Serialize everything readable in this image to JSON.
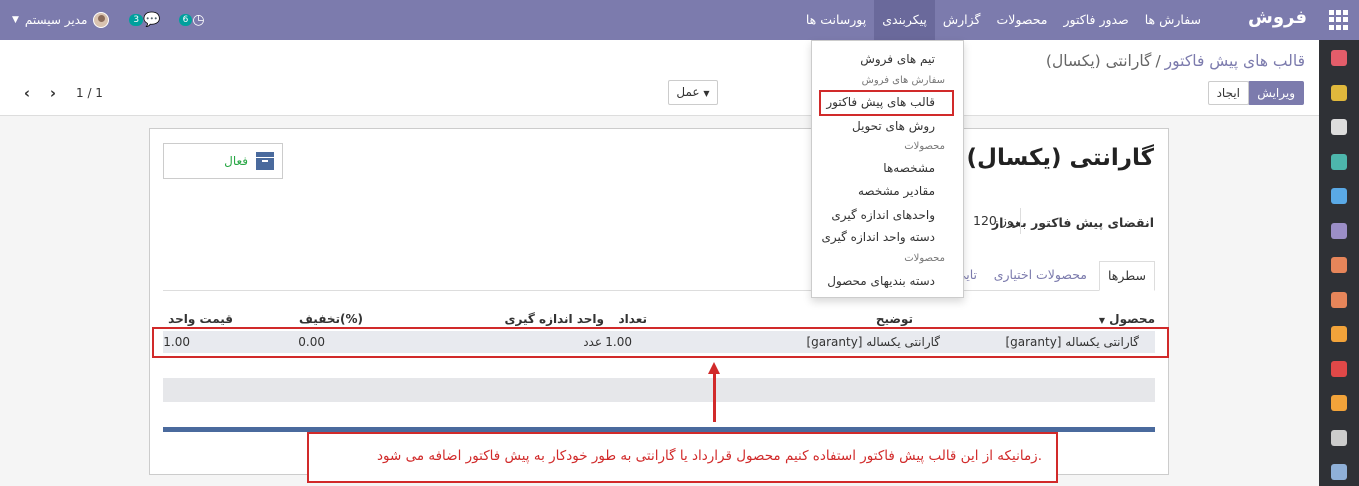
{
  "navbar": {
    "brand": "فروش",
    "menu": [
      "سفارش ها",
      "صدور فاکتور",
      "محصولات",
      "گزارش",
      "پیکربندی",
      "پورسانت ها"
    ],
    "active_menu": "پیکربندی",
    "user_name": "مدیر سیستم",
    "messages_badge": "3",
    "activities_badge": "6"
  },
  "breadcrumb": {
    "parent": "قالب های پیش فاکتور",
    "separator": "/",
    "current": "گارانتی (یکسال)"
  },
  "toolbar": {
    "edit_label": "ویرایش",
    "create_label": "ایجاد",
    "action_label": "عمل",
    "pager": "1 / 1"
  },
  "form": {
    "status_label": "فعال",
    "title": "گارانتی (یکسال)",
    "expiry_label": "انقضای پیش فاکتور بعد از",
    "expiry_value": "120 روز",
    "tabs": [
      "سطرها",
      "محصولات اختیاری",
      "تایی"
    ],
    "columns": [
      "محصول",
      "توضیح",
      "تعداد",
      "واحد اندازه گیری",
      "تخفیف(%)",
      "قیمت واحد"
    ],
    "rows": [
      {
        "product": "[garanty] گارانتی یکساله",
        "description": "[garanty] گارانتی یکساله",
        "quantity": "1.00",
        "uom": "عدد",
        "discount": "0.00",
        "unit_price": "1.00"
      }
    ]
  },
  "dropdown": {
    "items": [
      {
        "type": "item",
        "label": "تیم های فروش"
      },
      {
        "type": "header",
        "label": "سفارش های فروش"
      },
      {
        "type": "item",
        "label": "قالب های پیش فاکتور",
        "highlighted": true
      },
      {
        "type": "item",
        "label": "روش های تحویل"
      },
      {
        "type": "header",
        "label": "محصولات"
      },
      {
        "type": "item",
        "label": "مشخصه‌ها"
      },
      {
        "type": "item",
        "label": "مقادیر مشخصه"
      },
      {
        "type": "item",
        "label": "واحدهای اندازه گیری"
      },
      {
        "type": "item",
        "label": "دسته واحد اندازه گیری"
      },
      {
        "type": "header",
        "label": "محصولات"
      },
      {
        "type": "item",
        "label": "دسته بندیهای محصول"
      }
    ]
  },
  "annotation": {
    "text": "زمانیکه از این قالب پیش فاکتور استفاده کنیم محصول قرارداد یا گارانتی به طور خودکار به پیش فاکتور اضافه می شود."
  },
  "colors": {
    "navbar": "#7c7bad",
    "sidebar": "#2f3136",
    "highlight_red": "#d12a2a",
    "status_green": "#28a745",
    "accent_blue": "#4a6a9d"
  },
  "sidebar_icons": [
    {
      "name": "discuss-icon",
      "color": "#e35d6a"
    },
    {
      "name": "calendar-icon",
      "color": "#e0b83c"
    },
    {
      "name": "notes-icon",
      "color": "#dddddd"
    },
    {
      "name": "contacts-icon",
      "color": "#4db6ac"
    },
    {
      "name": "settings-icon",
      "color": "#5aa9e6"
    },
    {
      "name": "crm-icon",
      "color": "#9b8ec7"
    },
    {
      "name": "sales-icon",
      "color": "#e6855a"
    },
    {
      "name": "website-icon",
      "color": "#e6855a"
    },
    {
      "name": "invoicing-icon",
      "color": "#f2a33a"
    },
    {
      "name": "inventory-icon",
      "color": "#e04848"
    },
    {
      "name": "helpdesk-icon",
      "color": "#f2a33a"
    },
    {
      "name": "purchase-icon",
      "color": "#cccccc"
    },
    {
      "name": "pos-icon",
      "color": "#8fb0d8"
    }
  ]
}
